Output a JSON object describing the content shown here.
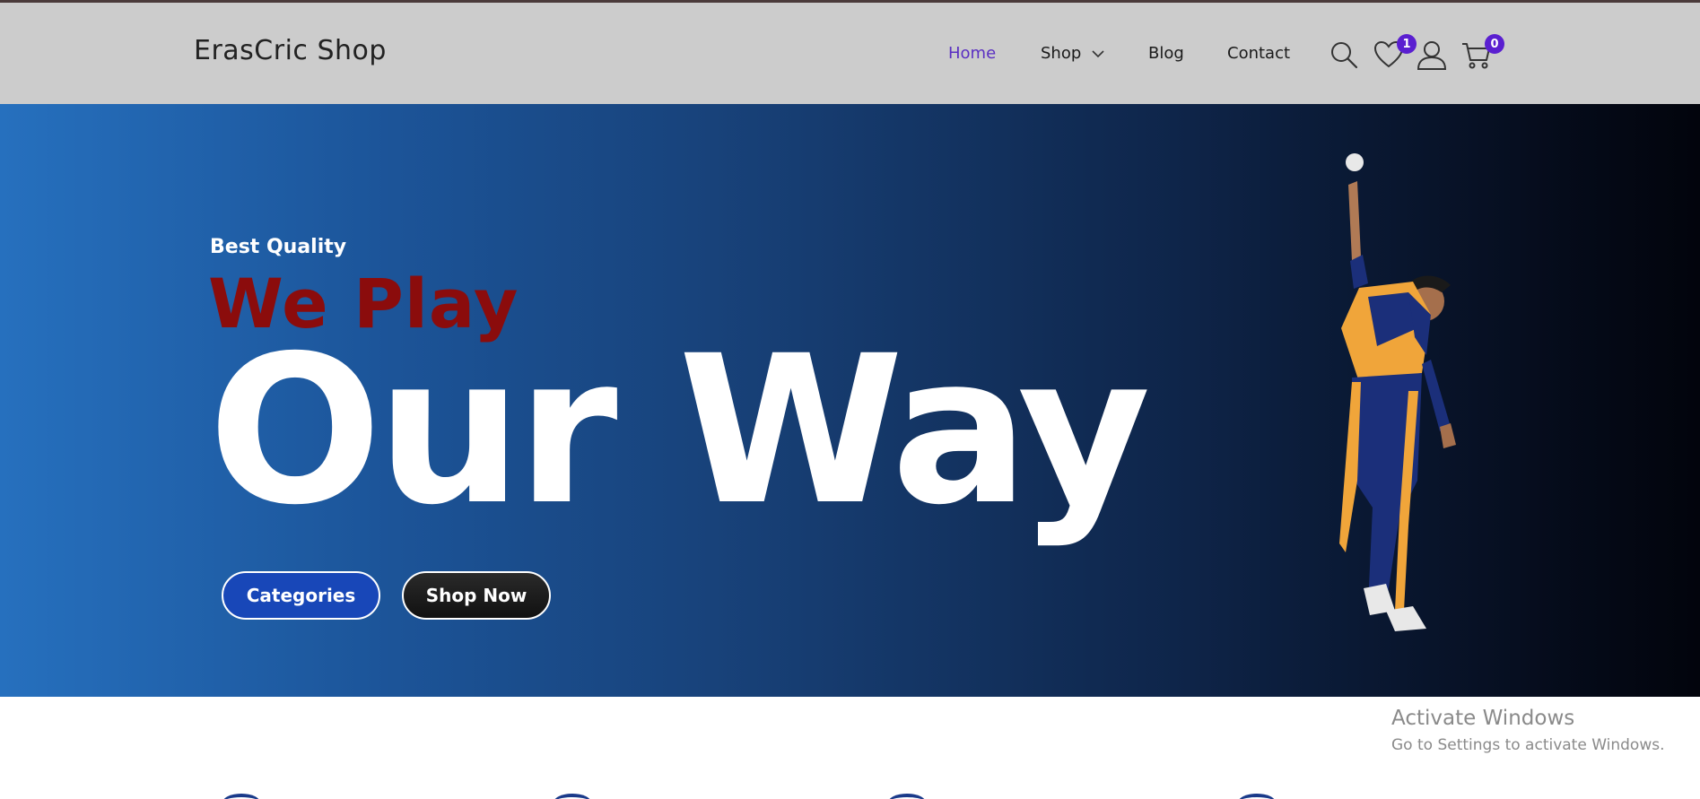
{
  "header": {
    "logo": "ErasCric Shop",
    "nav": [
      {
        "label": "Home",
        "active": true
      },
      {
        "label": "Shop",
        "has_dropdown": true
      },
      {
        "label": "Blog"
      },
      {
        "label": "Contact"
      }
    ],
    "icons": {
      "search": "search-icon",
      "wishlist": "heart-icon",
      "account": "user-icon",
      "cart": "cart-icon"
    },
    "wishlist_count": "1",
    "cart_count": "0"
  },
  "hero": {
    "subtitle": "Best Quality",
    "tagline": "We Play",
    "headline": "Our Way",
    "buttons": {
      "categories": "Categories",
      "shop_now": "Shop Now"
    }
  },
  "watermark": {
    "title": "Activate Windows",
    "subtitle": "Go to Settings to activate Windows."
  },
  "colors": {
    "header_bg": "#cccccc",
    "nav_active": "#5a2fc2",
    "badge": "#5a1fd0",
    "tagline": "#8b0c0c",
    "categories_button": "#1847b8",
    "shop_button": "#1a1a1a"
  }
}
